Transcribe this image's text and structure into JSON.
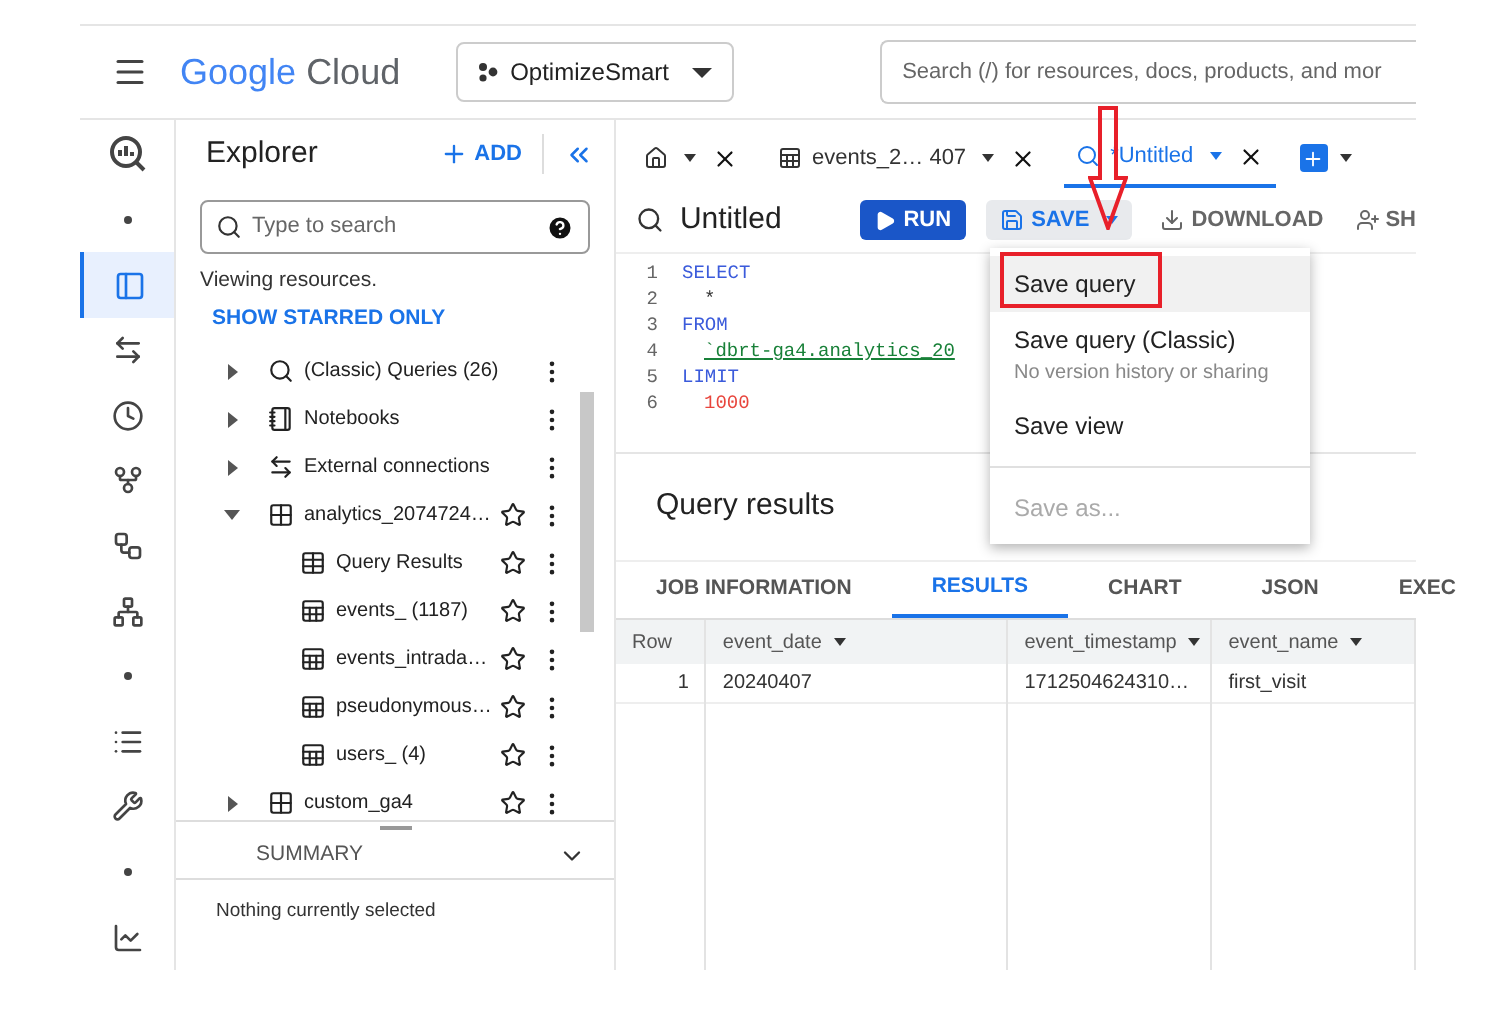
{
  "header": {
    "logo": {
      "google": "Google",
      "cloud": "Cloud"
    },
    "project": "OptimizeSmart",
    "search": {
      "placeholder": "Search (/) for resources, docs, products, and mor"
    }
  },
  "rail": [
    {
      "kind": "dot",
      "selected": false
    },
    {
      "kind": "explorer",
      "selected": true
    },
    {
      "kind": "transfers",
      "selected": false
    },
    {
      "kind": "history",
      "selected": false
    },
    {
      "kind": "scheduled",
      "selected": false
    },
    {
      "kind": "pipeline",
      "selected": false
    },
    {
      "kind": "hub",
      "selected": false
    },
    {
      "kind": "dot",
      "selected": false
    },
    {
      "kind": "list",
      "selected": false
    },
    {
      "kind": "wrench",
      "selected": false
    },
    {
      "kind": "dot",
      "selected": false
    },
    {
      "kind": "chart",
      "selected": false
    }
  ],
  "explorer": {
    "title": "Explorer",
    "add": "ADD",
    "search": {
      "placeholder": "Type to search"
    },
    "status": "Viewing resources.",
    "starred_link": "SHOW STARRED ONLY",
    "tree": [
      {
        "label": "(Classic) Queries (26)",
        "kind": "queries",
        "expanded": false
      },
      {
        "label": "Notebooks",
        "kind": "notebook",
        "expanded": false
      },
      {
        "label": "External connections",
        "kind": "connection",
        "expanded": false
      },
      {
        "label": "analytics_2074724…",
        "kind": "dataset",
        "expanded": true,
        "starred": false,
        "children": [
          {
            "label": "Query Results",
            "kind": "results",
            "starred": false
          },
          {
            "label": "events_ (1187)",
            "kind": "table",
            "starred": false
          },
          {
            "label": "events_intrada…",
            "kind": "table",
            "starred": false
          },
          {
            "label": "pseudonymous…",
            "kind": "table",
            "starred": false
          },
          {
            "label": "users_ (4)",
            "kind": "table",
            "starred": false
          }
        ]
      },
      {
        "label": "custom_ga4",
        "kind": "dataset",
        "expanded": false,
        "starred": false
      }
    ],
    "summary": {
      "title": "SUMMARY",
      "empty": "Nothing currently selected"
    }
  },
  "tabs": [
    {
      "kind": "home",
      "selected": false
    },
    {
      "label": "events_2… 407",
      "kind": "table",
      "selected": false
    },
    {
      "label": "*Untitled",
      "kind": "query",
      "selected": true
    }
  ],
  "query": {
    "title": "Untitled",
    "run": "RUN",
    "save": "SAVE",
    "download": "DOWNLOAD",
    "share": "SH"
  },
  "editor": [
    {
      "number": "1",
      "text": "SELECT",
      "kind": "keyword"
    },
    {
      "number": "2",
      "text": "*",
      "kind": "plain"
    },
    {
      "number": "3",
      "text": "FROM",
      "kind": "keyword"
    },
    {
      "number": "4",
      "text": "`dbrt-ga4.analytics_20",
      "kind": "string"
    },
    {
      "number": "5",
      "text": "LIMIT",
      "kind": "keyword"
    },
    {
      "number": "6",
      "text": "1000",
      "kind": "number"
    }
  ],
  "save_menu": [
    {
      "kind": "item",
      "label": "Save query",
      "selected": true,
      "disabled": false
    },
    {
      "kind": "item",
      "label": "Save query (Classic)",
      "sublabel": "No version history or sharing",
      "selected": false,
      "disabled": false
    },
    {
      "kind": "item",
      "label": "Save view",
      "selected": false,
      "disabled": false
    },
    {
      "kind": "divider"
    },
    {
      "kind": "item",
      "label": "Save as...",
      "selected": false,
      "disabled": true
    }
  ],
  "results": {
    "title": "Query results",
    "tabs": [
      {
        "label": "JOB INFORMATION",
        "selected": false
      },
      {
        "label": "RESULTS",
        "selected": true
      },
      {
        "label": "CHART",
        "selected": false
      },
      {
        "label": "JSON",
        "selected": false
      },
      {
        "label": "EXEC",
        "selected": false
      }
    ],
    "columns": [
      "Row",
      "event_date",
      "event_timestamp",
      "event_name"
    ],
    "rows": [
      [
        "1",
        "20240407",
        "1712504624310…",
        "first_visit"
      ]
    ]
  }
}
